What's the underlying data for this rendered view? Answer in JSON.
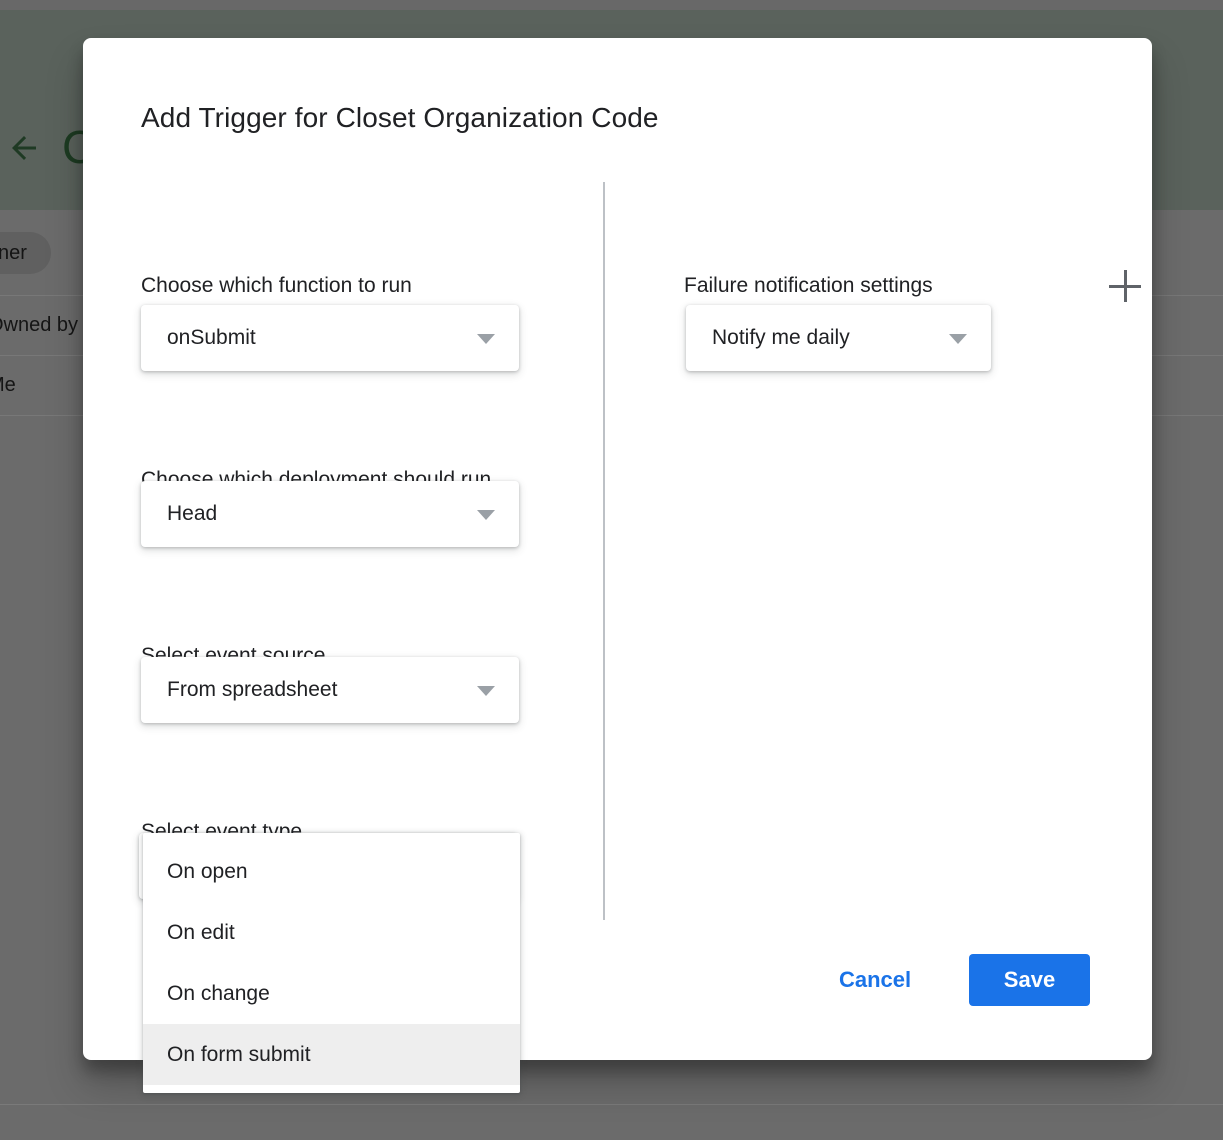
{
  "background": {
    "back_arrow_icon": "arrow-left-icon",
    "logo_letter": "C",
    "owner_chip": "Owner",
    "rows": [
      "Owned by",
      "Me"
    ]
  },
  "dialog": {
    "title": "Add Trigger for Closet Organization Code",
    "left_column": {
      "fields": [
        {
          "label": "Choose which function to run",
          "value": "onSubmit",
          "caret_icon": "chevron-down-icon"
        },
        {
          "label": "Choose which deployment should run",
          "value": "Head",
          "caret_icon": "chevron-down-icon"
        },
        {
          "label": "Select event source",
          "value": "From spreadsheet",
          "caret_icon": "chevron-down-icon"
        },
        {
          "label": "Select event type",
          "value": "On form submit",
          "caret_icon": "chevron-down-icon"
        }
      ],
      "event_type_menu": {
        "open": true,
        "options": [
          {
            "label": "On open",
            "selected": false
          },
          {
            "label": "On edit",
            "selected": false
          },
          {
            "label": "On change",
            "selected": false
          },
          {
            "label": "On form submit",
            "selected": true
          }
        ]
      }
    },
    "right_column": {
      "heading": "Failure notification settings",
      "add_icon": "plus-icon",
      "notify_field": {
        "value": "Notify me daily",
        "caret_icon": "chevron-down-icon"
      }
    },
    "footer": {
      "cancel_label": "Cancel",
      "save_label": "Save"
    }
  },
  "colors": {
    "accent_blue": "#1a73e8",
    "divider_grey": "#bdc1c6",
    "caret_grey": "#9aa0a6",
    "text_primary": "#202124",
    "menu_selected_bg": "#eeeeee",
    "backdrop_grey": "#6b6b6b",
    "header_green_grey": "#5a625c"
  }
}
